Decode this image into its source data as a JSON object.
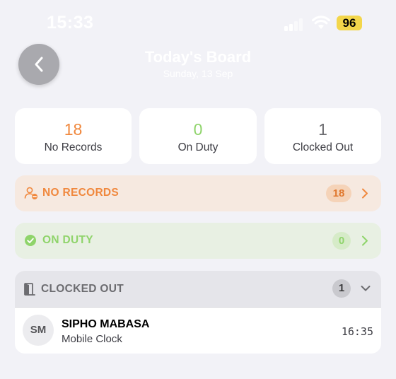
{
  "status_bar": {
    "time": "15:33",
    "battery": "96",
    "battery_color": "#f3d64b"
  },
  "header": {
    "title": "Today's Board",
    "subtitle": "Sunday, 13 Sep",
    "back_icon": "chevron-left-icon"
  },
  "stats": [
    {
      "value": "18",
      "label": "No Records",
      "color": "#f0883e"
    },
    {
      "value": "0",
      "label": "On Duty",
      "color": "#8fd46b"
    },
    {
      "value": "1",
      "label": "Clocked Out",
      "color": "#6c6c70"
    }
  ],
  "sections": {
    "no_records": {
      "label": "NO RECORDS",
      "count": "18",
      "icon": "person-minus-icon",
      "color": "#f0883e",
      "background": "#f6e9e0"
    },
    "on_duty": {
      "label": "ON DUTY",
      "count": "0",
      "icon": "check-circle-icon",
      "color": "#8fd46b",
      "background": "#e8f0e3"
    },
    "clocked_out": {
      "label": "CLOCKED OUT",
      "count": "1",
      "icon": "door-icon",
      "chevron": "chevron-down-icon",
      "people": [
        {
          "initials": "SM",
          "name": "SIPHO MABASA",
          "method": "Mobile Clock",
          "time": "16:35"
        }
      ]
    }
  }
}
